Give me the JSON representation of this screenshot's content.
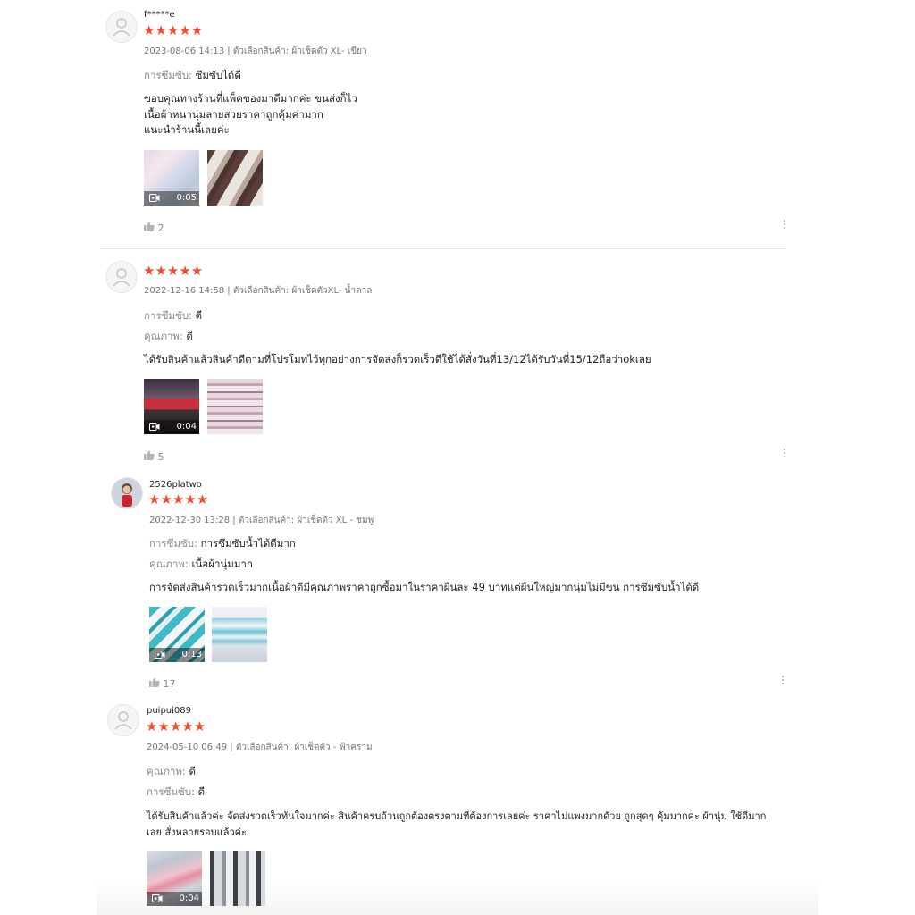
{
  "reviews": [
    {
      "username": "f*****e",
      "stars": "★★★★★",
      "meta": "2023-08-06 14:13 | ตัวเลือกสินค้า: ผ้าเช็ดตัว XL- เขียว",
      "attributes": [
        {
          "key": "การซึมซับ:",
          "value": "ซึมซับได้ดี"
        }
      ],
      "body": [
        "ขอบคุณทางร้านที่แพ็คของมาดีมากค่ะ ขนส่งก็ไว",
        "เนื้อผ้าหนานุ่มลายสวยราคาถูกคุ้มค่ามาก",
        "แนะนำร้านนี้เลยค่ะ"
      ],
      "video_duration": "0:05",
      "likes": "2"
    },
    {
      "username": "",
      "stars": "★★★★★",
      "meta": "2022-12-16 14:58 | ตัวเลือกสินค้า: ผ้าเช็ดตัวXL- น้ำตาล",
      "attributes": [
        {
          "key": "การซึมซับ:",
          "value": "ดี"
        },
        {
          "key": "คุณภาพ:",
          "value": "ดี"
        }
      ],
      "body": [
        "ได้รับสินค้าแล้วสินค้าดีตามที่โปรโมทไว้ทุกอย่างการจัดส่งก็รวดเร็วดีใช้ได้สั่งวันที่13/12ได้รับวันที่15/12ถือว่าokเลย"
      ],
      "video_duration": "0:04",
      "likes": "5"
    },
    {
      "username": "2526platwo",
      "stars": "★★★★★",
      "meta": "2022-12-30 13:28 | ตัวเลือกสินค้า: ผ้าเช็ดตัว XL - ชมพู",
      "attributes": [
        {
          "key": "การซึมซับ:",
          "value": "การซึมซับน้ำได้ดีมาก"
        },
        {
          "key": "คุณภาพ:",
          "value": "เนื้อผ้านุ่มมาก"
        }
      ],
      "body": [
        "การจัดส่งสินค้ารวดเร็วมากเนื้อผ้าดีมีคุณภาพราคาถูกซื้อมาในราคาผืนละ 49 บาทแต่ผืนใหญ่มากนุ่มไม่มีขน การซึมซับน้ำได้ดี"
      ],
      "video_duration": "0:13",
      "likes": "17"
    },
    {
      "username": "puipui089",
      "stars": "★★★★★",
      "meta": "2024-05-10 06:49 | ตัวเลือกสินค้า: ผ้าเช็ดตัว - ฟ้าคราม",
      "attributes": [
        {
          "key": "คุณภาพ:",
          "value": "ดี"
        },
        {
          "key": "การซึมซับ:",
          "value": "ดี"
        }
      ],
      "body": [
        "ได้รับสินค้าแล้วค่ะ จัดส่งรวดเร็วทันใจมากค่ะ สินค้าครบถ้วนถูกต้องตรงตามที่ต้องการเลยค่ะ ราคาไม่แพงมากด้วย ถูกสุดๆ คุ้มมากค่ะ ผ้านุ่ม ใช้ดีมาก",
        "เลย สั่งหลายรอบแล้วค่ะ"
      ],
      "video_duration": "0:04",
      "likes": ""
    }
  ],
  "icons": {
    "like": "thumbs-up-icon",
    "more": "more-vertical-icon",
    "video": "video-camera-icon",
    "avatar": "default-avatar-icon"
  },
  "colors": {
    "star": "#ee4d2d",
    "muted": "#757575",
    "text": "#222222"
  }
}
